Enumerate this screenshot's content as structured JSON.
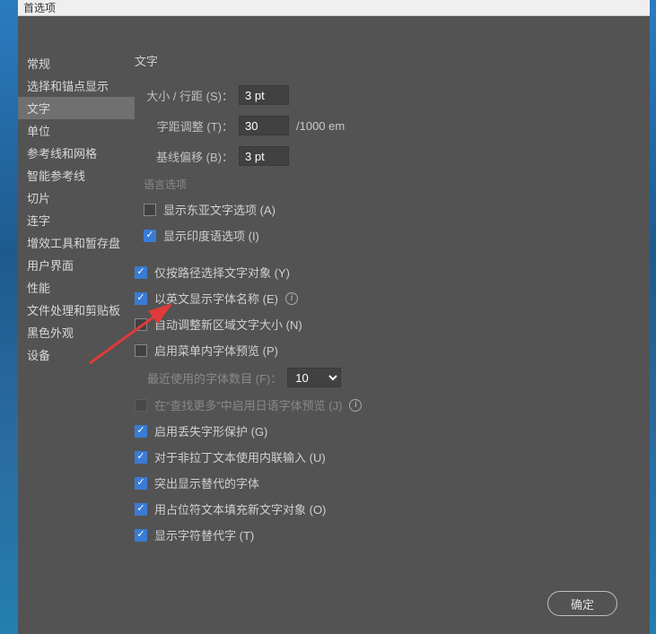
{
  "window": {
    "title": "首选项"
  },
  "sidebar": {
    "items": [
      {
        "label": "常规"
      },
      {
        "label": "选择和锚点显示"
      },
      {
        "label": "文字"
      },
      {
        "label": "单位"
      },
      {
        "label": "参考线和网格"
      },
      {
        "label": "智能参考线"
      },
      {
        "label": "切片"
      },
      {
        "label": "连字"
      },
      {
        "label": "增效工具和暂存盘"
      },
      {
        "label": "用户界面"
      },
      {
        "label": "性能"
      },
      {
        "label": "文件处理和剪贴板"
      },
      {
        "label": "黑色外观"
      },
      {
        "label": "设备"
      }
    ],
    "activeIndex": 2
  },
  "panel": {
    "title": "文字",
    "sizeLabel": "大小 / 行距 (S)：",
    "sizeValue": "3 pt",
    "trackingLabel": "字距调整 (T)：",
    "trackingValue": "30",
    "trackingSuffix": "/1000 em",
    "baselineLabel": "基线偏移 (B)：",
    "baselineValue": "3 pt",
    "langOptionsTitle": "语言选项",
    "checks": {
      "eastAsian": {
        "label": "显示东亚文字选项 (A)",
        "checked": false
      },
      "indic": {
        "label": "显示印度语选项 (I)",
        "checked": true
      },
      "pathOnly": {
        "label": "仅按路径选择文字对象 (Y)",
        "checked": true
      },
      "englishFont": {
        "label": "以英文显示字体名称 (E)",
        "checked": true
      },
      "autoSize": {
        "label": "自动调整新区域文字大小 (N)",
        "checked": false
      },
      "menuPreview": {
        "label": "启用菜单内字体预览 (P)",
        "checked": false
      },
      "jpPreview": {
        "label": "在“查找更多”中启用日语字体预览 (J)",
        "checked": false,
        "disabled": true
      },
      "missingGlyph": {
        "label": "启用丢失字形保护 (G)",
        "checked": true
      },
      "inlineInput": {
        "label": "对于非拉丁文本使用内联输入 (U)",
        "checked": true
      },
      "highlightAlt": {
        "label": "突出显示替代的字体",
        "checked": true
      },
      "placeholder": {
        "label": "用占位符文本填充新文字对象 (O)",
        "checked": true
      },
      "showAlt": {
        "label": "显示字符替代字 (T)",
        "checked": true
      }
    },
    "recentFontsLabel": "最近使用的字体数目 (F)：",
    "recentFontsValue": "10"
  },
  "footer": {
    "ok": "确定"
  }
}
